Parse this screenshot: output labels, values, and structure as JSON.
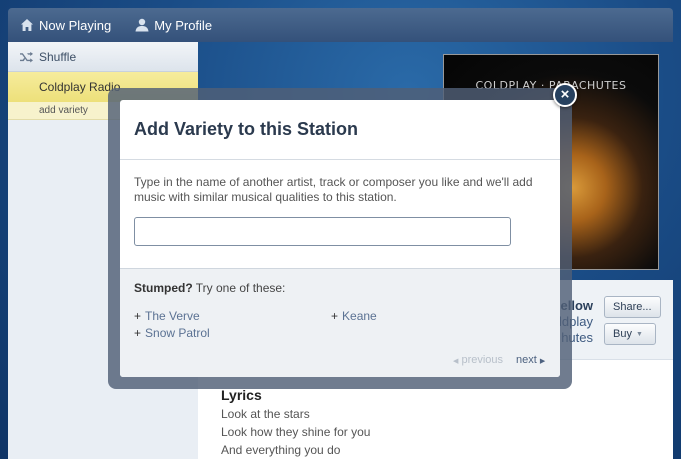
{
  "nav": {
    "now_playing": "Now Playing",
    "my_profile": "My Profile"
  },
  "sidebar": {
    "shuffle": "Shuffle",
    "station_name": "Coldplay Radio",
    "add_variety": "add variety"
  },
  "album": {
    "cover_title": "COLDPLAY · PARACHUTES"
  },
  "song": {
    "title_partial": "ellow",
    "artist_partial": "oldplay",
    "album_partial": "hutes",
    "share_label": "Share...",
    "buy_label": "Buy"
  },
  "lyrics": {
    "heading": "Lyrics",
    "lines": [
      "Look at the stars",
      "Look how they shine for you",
      "And everything you do"
    ]
  },
  "modal": {
    "title": "Add Variety to this Station",
    "description": "Type in the name of another artist, track or composer you like and we'll add music with similar musical qualities to this station.",
    "input_value": "",
    "stumped_bold": "Stumped?",
    "stumped_rest": " Try one of these:",
    "suggestions": [
      "The Verve",
      "Keane",
      "Snow Patrol"
    ],
    "plus_glyph": "+",
    "prev_label": "previous",
    "next_label": "next",
    "close_glyph": "×"
  },
  "icons": {
    "home": "home-icon",
    "profile": "user-icon",
    "shuffle": "shuffle-icon",
    "close": "close-icon"
  },
  "colors": {
    "background": "#1a4c86",
    "station_highlight": "#ede07a",
    "link": "#5b7293"
  }
}
